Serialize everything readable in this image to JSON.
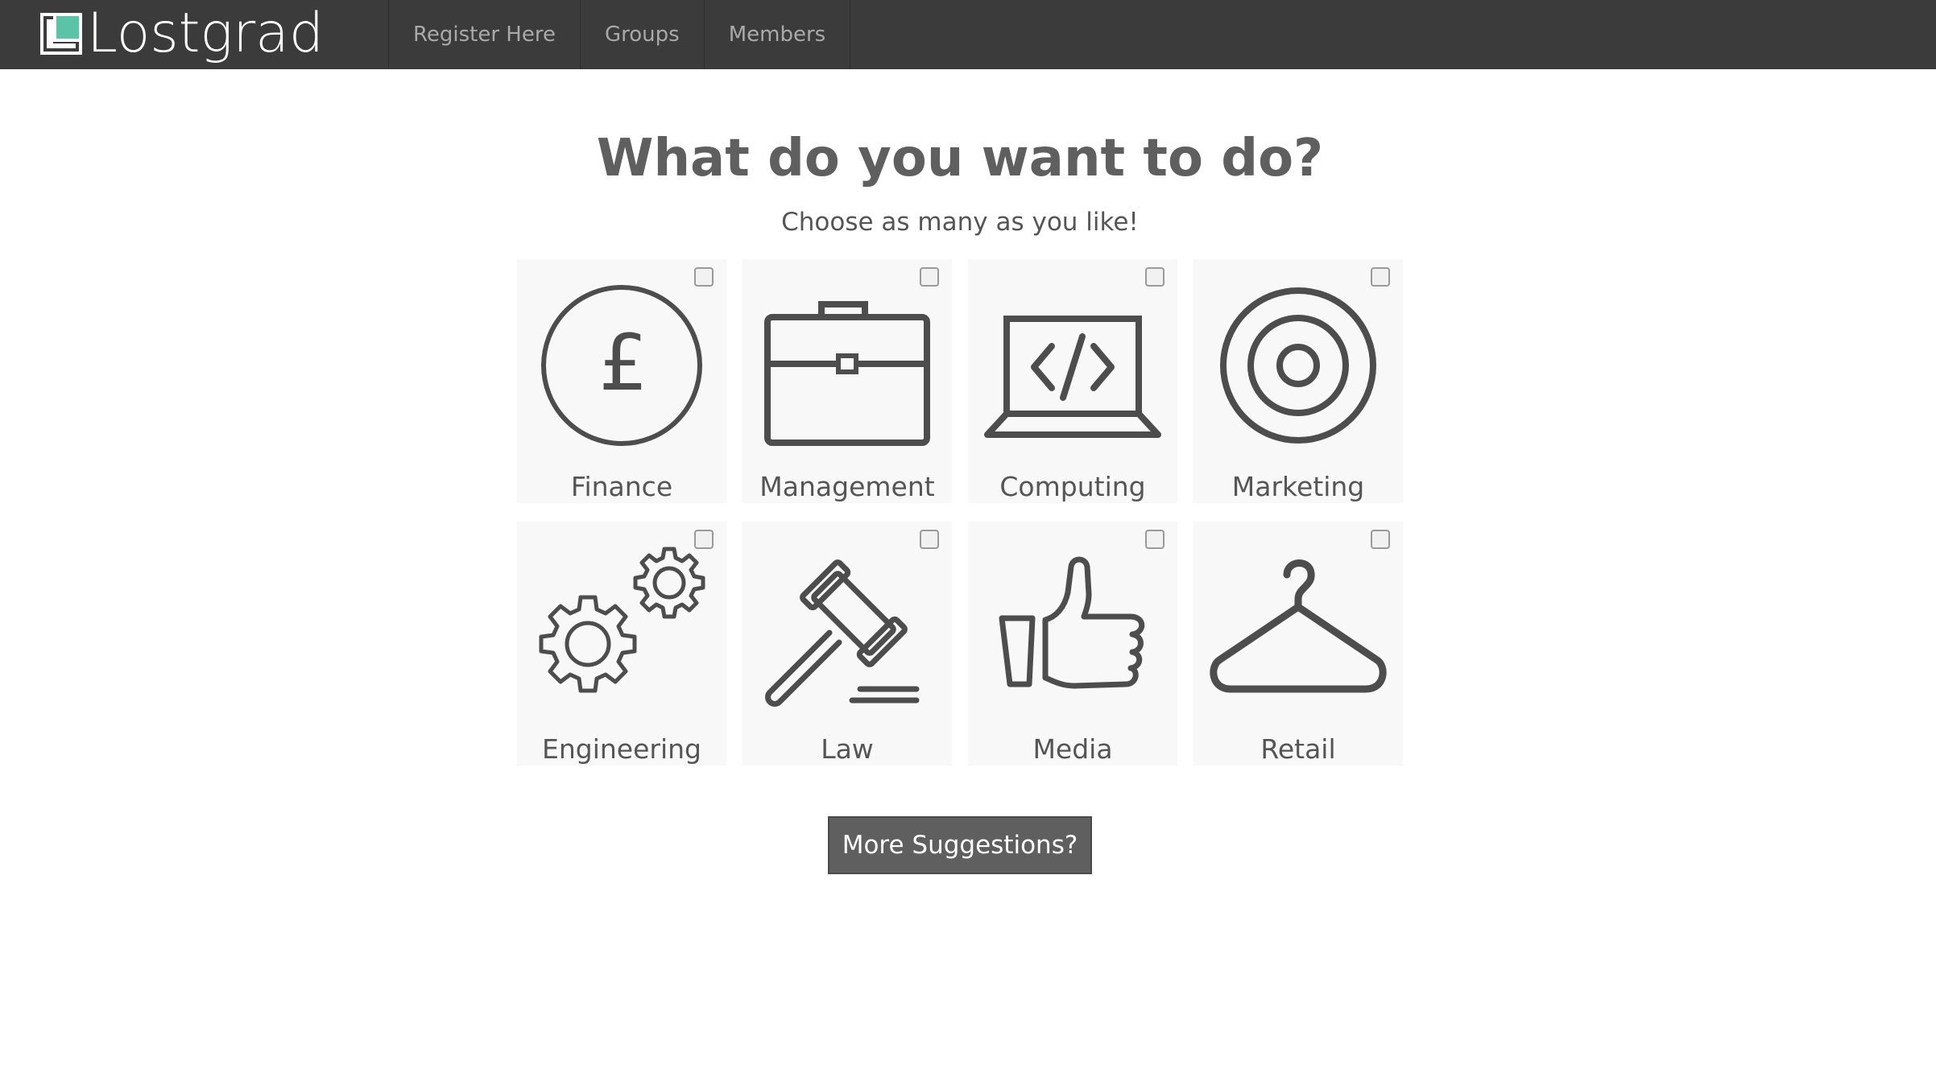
{
  "brand": {
    "name": "Lostgrad",
    "logo_color": "#5bc3a8"
  },
  "nav": {
    "links": [
      {
        "label": "Register Here"
      },
      {
        "label": "Groups"
      },
      {
        "label": "Members"
      }
    ]
  },
  "main": {
    "title": "What do you want to do?",
    "subtitle": "Choose as many as you like!",
    "options": [
      {
        "label": "Finance",
        "icon": "pound-icon",
        "checked": false
      },
      {
        "label": "Management",
        "icon": "briefcase-icon",
        "checked": false
      },
      {
        "label": "Computing",
        "icon": "laptop-code-icon",
        "checked": false
      },
      {
        "label": "Marketing",
        "icon": "target-icon",
        "checked": false
      },
      {
        "label": "Engineering",
        "icon": "gears-icon",
        "checked": false
      },
      {
        "label": "Law",
        "icon": "gavel-icon",
        "checked": false
      },
      {
        "label": "Media",
        "icon": "thumbs-up-icon",
        "checked": false
      },
      {
        "label": "Retail",
        "icon": "hanger-icon",
        "checked": false
      }
    ],
    "more_button": "More Suggestions?"
  },
  "colors": {
    "navbar": "#3b3b3b",
    "card_bg": "#f8f8f8",
    "icon_stroke": "#4d4d4d",
    "button_bg": "#5f5f5f"
  }
}
